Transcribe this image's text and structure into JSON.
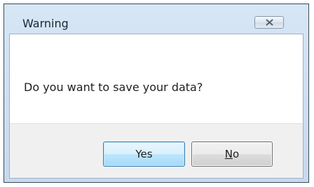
{
  "window": {
    "title": "Warning",
    "close_icon": "close-x-icon"
  },
  "message": "Do you want to save your data?",
  "buttons": {
    "yes_label": "Yes",
    "no_mnemonic": "N",
    "no_rest": "o",
    "default_button": "Yes"
  },
  "colors": {
    "frame": "#c7d9ee",
    "client_background": "#ffffff",
    "button_strip": "#f0f0f0",
    "default_button_border": "#3c7fb1"
  }
}
